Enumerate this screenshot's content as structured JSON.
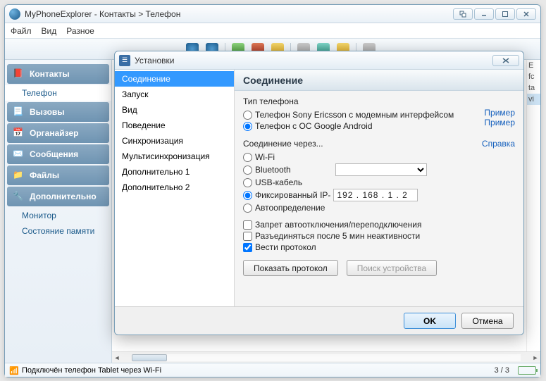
{
  "window": {
    "title": "MyPhoneExplorer -  Контакты > Телефон"
  },
  "menu": {
    "file": "Файл",
    "view": "Вид",
    "misc": "Разное"
  },
  "sidebar": {
    "groups": [
      {
        "label": "Контакты",
        "items": [
          {
            "label": "Телефон",
            "active": true
          }
        ]
      },
      {
        "label": "Вызовы",
        "items": []
      },
      {
        "label": "Органайзер",
        "items": []
      },
      {
        "label": "Сообщения",
        "items": []
      },
      {
        "label": "Файлы",
        "items": []
      },
      {
        "label": "Дополнительно",
        "items": [
          {
            "label": "Монитор"
          },
          {
            "label": "Состояние памяти"
          }
        ]
      }
    ]
  },
  "right_letters": [
    "E",
    "fc",
    "ta",
    "vi"
  ],
  "status": {
    "text": "Подключён телефон Tablet через Wi-Fi",
    "count": "3 / 3"
  },
  "dialog": {
    "title": "Установки",
    "nav": [
      "Соединение",
      "Запуск",
      "Вид",
      "Поведение",
      "Синхронизация",
      "Мультисинхронизация",
      "Дополнительно 1",
      "Дополнительно 2"
    ],
    "panel": {
      "heading": "Соединение",
      "phone_type_label": "Тип телефона",
      "phone_type_options": [
        "Телефон Sony Ericsson с модемным интерфейсом",
        "Телефон с ОС Google Android"
      ],
      "phone_type_selected": 1,
      "example_link": "Пример",
      "connect_via_label": "Соединение через...",
      "help_link": "Справка",
      "connect_options": [
        "Wi-Fi",
        "Bluetooth",
        "USB-кабель",
        "Фиксированный IP-",
        "Автоопределение"
      ],
      "connect_selected": 3,
      "ip_value": "192 . 168 .   1  .   2",
      "checks": [
        {
          "label": "Запрет автоотключения/переподключения",
          "checked": false
        },
        {
          "label": "Разъединяться после 5 мин неактивности",
          "checked": false
        },
        {
          "label": "Вести протокол",
          "checked": true
        }
      ],
      "show_log_btn": "Показать протокол",
      "search_device_btn": "Поиск устройства"
    },
    "ok": "OK",
    "cancel": "Отмена"
  }
}
